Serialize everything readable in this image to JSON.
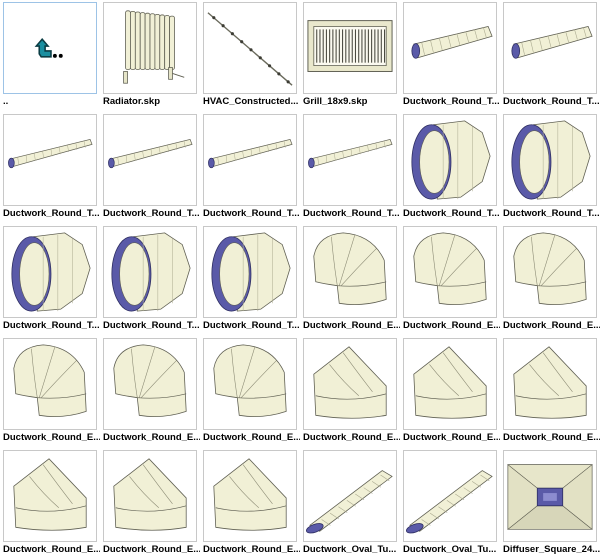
{
  "items": [
    {
      "label": "..",
      "icon": "parent-folder-icon"
    },
    {
      "label": "Radiator.skp",
      "icon": "radiator-icon"
    },
    {
      "label": "HVAC_Constructed...",
      "icon": "hvac-run-icon"
    },
    {
      "label": "Grill_18x9.skp",
      "icon": "grill-icon"
    },
    {
      "label": "Ductwork_Round_T...",
      "icon": "duct-long-thick-icon"
    },
    {
      "label": "Ductwork_Round_T...",
      "icon": "duct-long-thick-icon"
    },
    {
      "label": "Ductwork_Round_T...",
      "icon": "duct-long-icon"
    },
    {
      "label": "Ductwork_Round_T...",
      "icon": "duct-long-icon"
    },
    {
      "label": "Ductwork_Round_T...",
      "icon": "duct-long-icon"
    },
    {
      "label": "Ductwork_Round_T...",
      "icon": "duct-long-icon"
    },
    {
      "label": "Ductwork_Round_T...",
      "icon": "duct-ring-icon"
    },
    {
      "label": "Ductwork_Round_T...",
      "icon": "duct-ring-icon"
    },
    {
      "label": "Ductwork_Round_T...",
      "icon": "duct-ring-icon"
    },
    {
      "label": "Ductwork_Round_T...",
      "icon": "duct-ring-icon"
    },
    {
      "label": "Ductwork_Round_T...",
      "icon": "duct-ring-icon"
    },
    {
      "label": "Ductwork_Round_E...",
      "icon": "elbow-90-icon"
    },
    {
      "label": "Ductwork_Round_E...",
      "icon": "elbow-90-icon"
    },
    {
      "label": "Ductwork_Round_E...",
      "icon": "elbow-90-icon"
    },
    {
      "label": "Ductwork_Round_E...",
      "icon": "elbow-90-icon"
    },
    {
      "label": "Ductwork_Round_E...",
      "icon": "elbow-90-icon"
    },
    {
      "label": "Ductwork_Round_E...",
      "icon": "elbow-90-icon"
    },
    {
      "label": "Ductwork_Round_E...",
      "icon": "elbow-45-icon"
    },
    {
      "label": "Ductwork_Round_E...",
      "icon": "elbow-45-icon"
    },
    {
      "label": "Ductwork_Round_E...",
      "icon": "elbow-45-icon"
    },
    {
      "label": "Ductwork_Round_E...",
      "icon": "elbow-45-icon"
    },
    {
      "label": "Ductwork_Round_E...",
      "icon": "elbow-45-icon"
    },
    {
      "label": "Ductwork_Round_E...",
      "icon": "elbow-45-icon"
    },
    {
      "label": "Ductwork_Oval_Tu...",
      "icon": "oval-duct-icon"
    },
    {
      "label": "Ductwork_Oval_Tu...",
      "icon": "oval-duct-icon"
    },
    {
      "label": "Diffuser_Square_24...",
      "icon": "diffuser-icon"
    }
  ],
  "colors": {
    "cream": "#f1f0d6",
    "creamShade": "#dcdbbd",
    "outline": "#5f5f52",
    "inner": "#5a5aa8",
    "border": "#c8c8c8"
  }
}
